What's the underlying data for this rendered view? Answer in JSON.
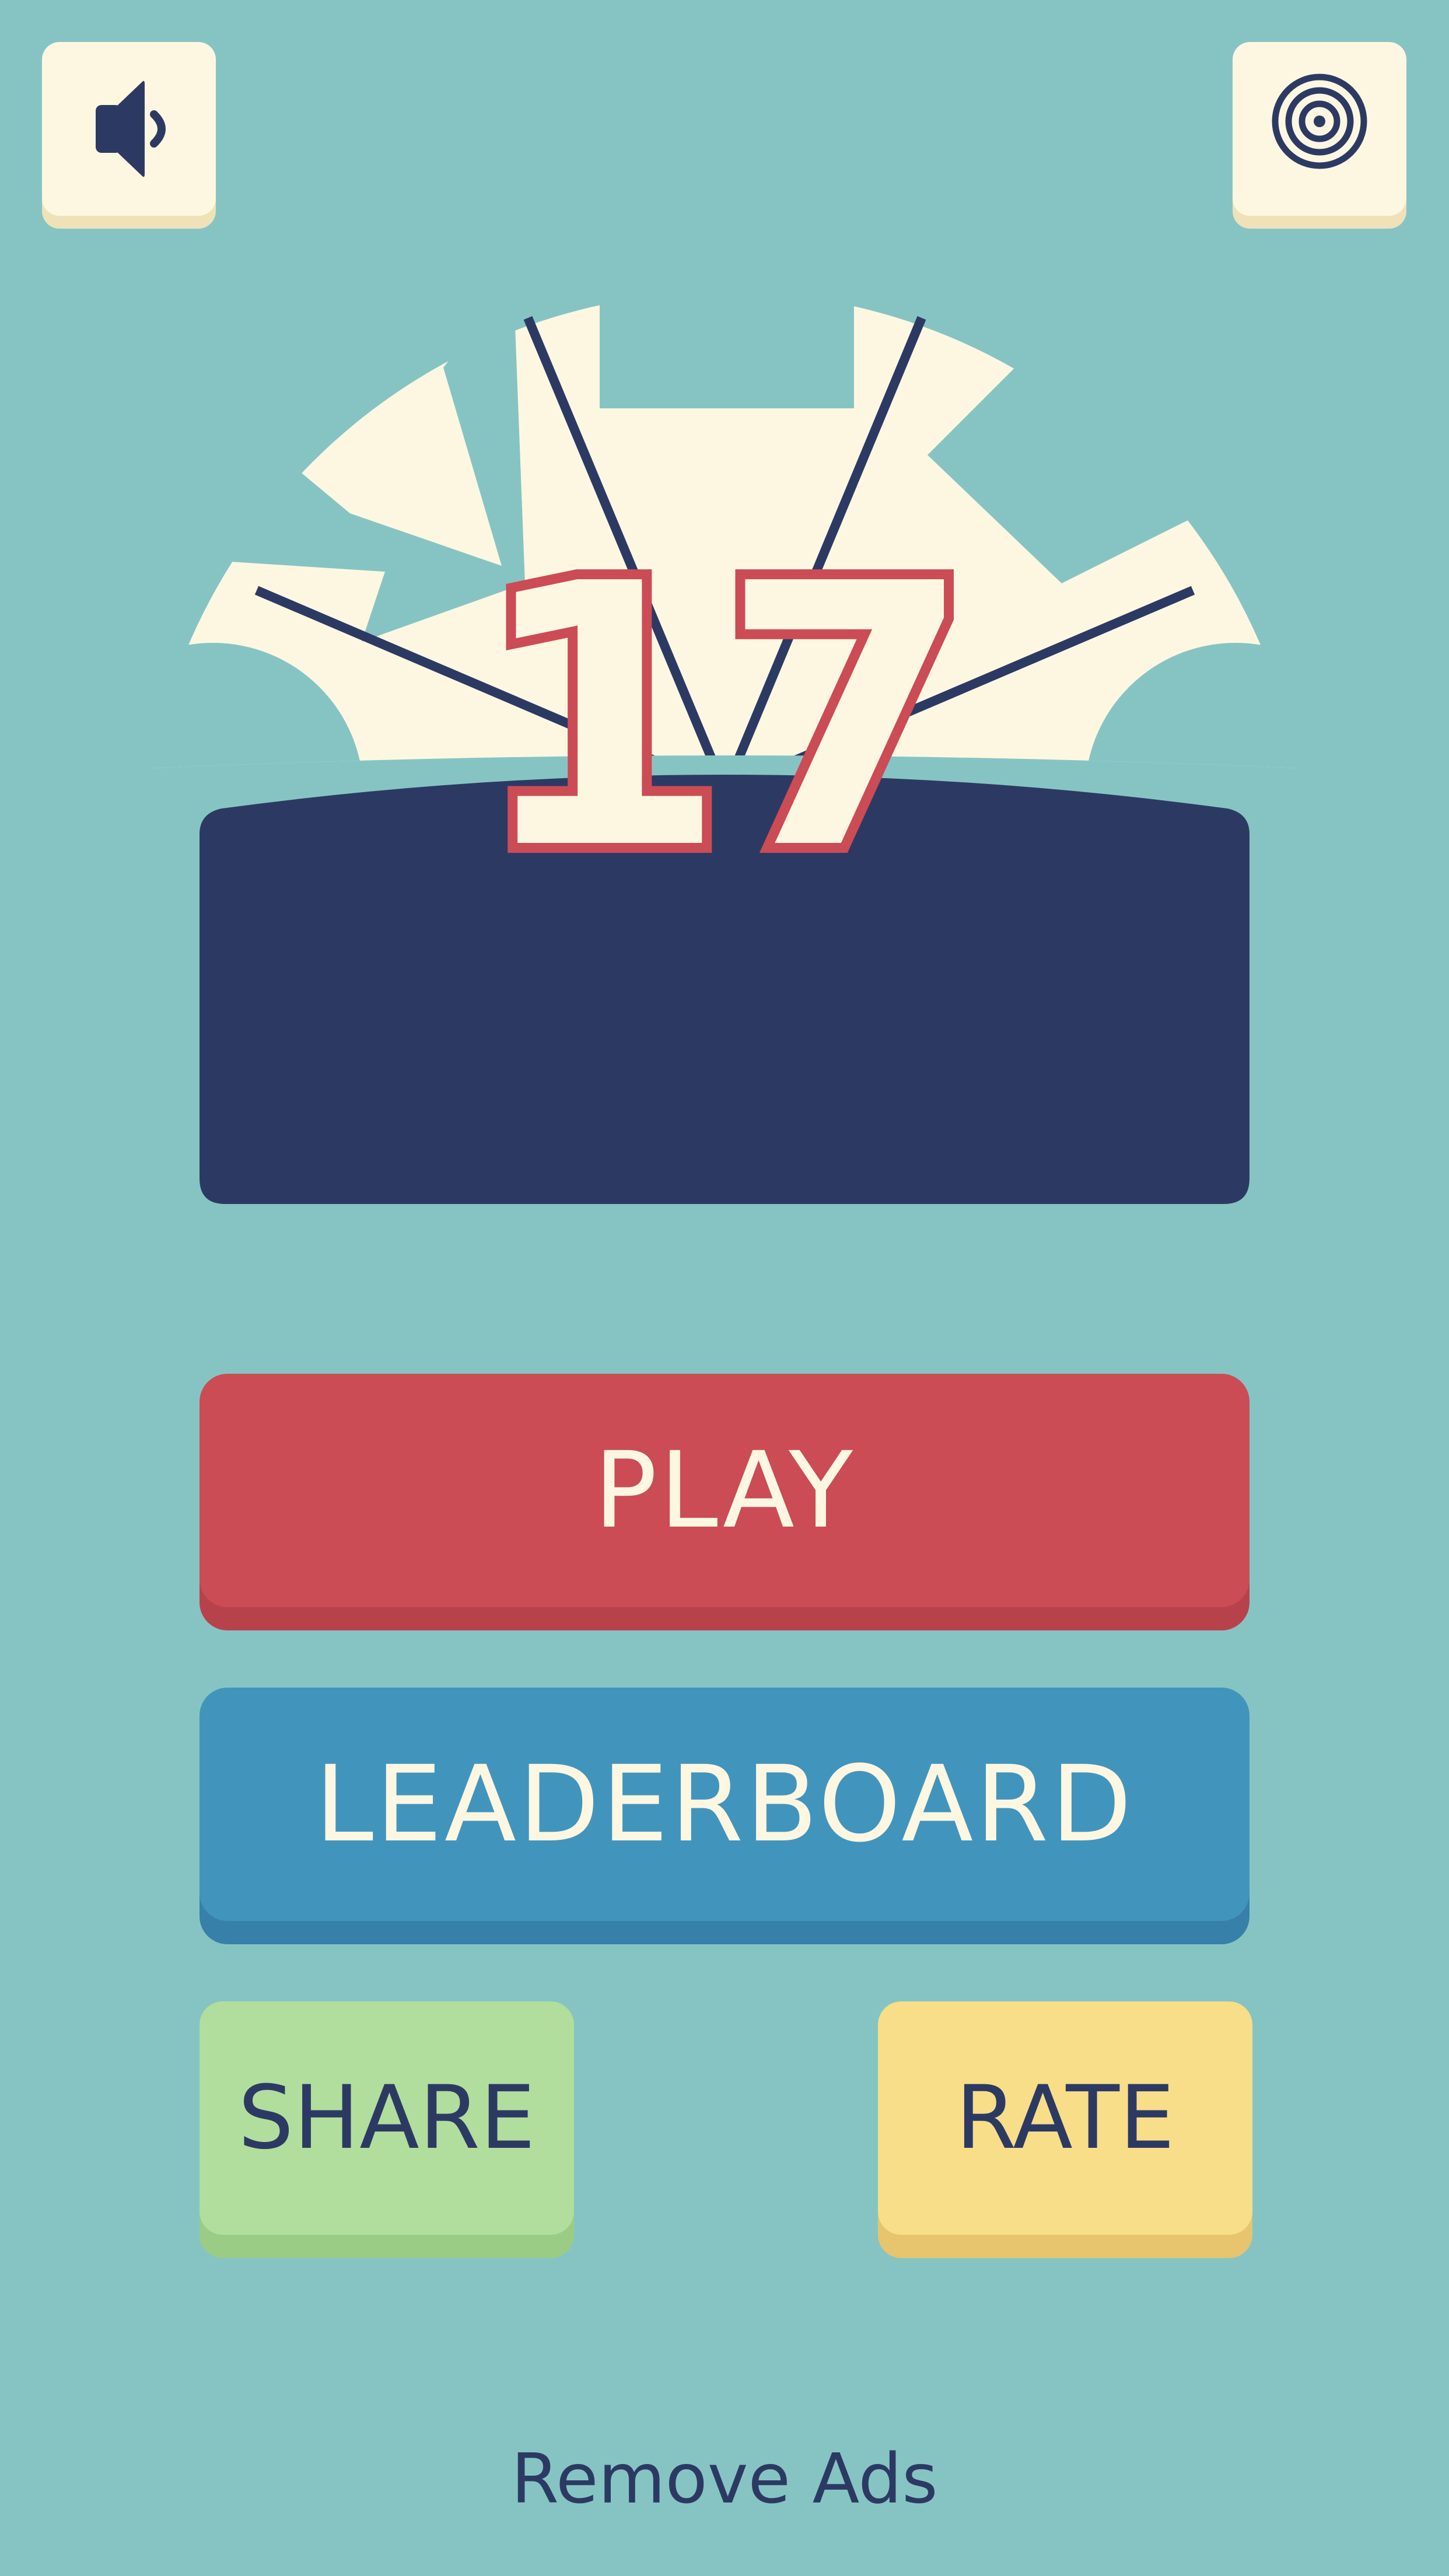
{
  "score": "17",
  "buttons": {
    "play": "PLAY",
    "leaderboard": "LEADERBOARD",
    "share": "SHARE",
    "rate": "RATE",
    "remove_ads": "Remove Ads"
  },
  "icons": {
    "sound": "speaker-icon",
    "target": "target-icon"
  },
  "colors": {
    "background": "#86c4c4",
    "cream": "#fdf7e1",
    "navy": "#2c3a63",
    "play": "#cb4c55",
    "leaderboard": "#4195bd",
    "share": "#b1de9c",
    "rate": "#f8de88"
  }
}
